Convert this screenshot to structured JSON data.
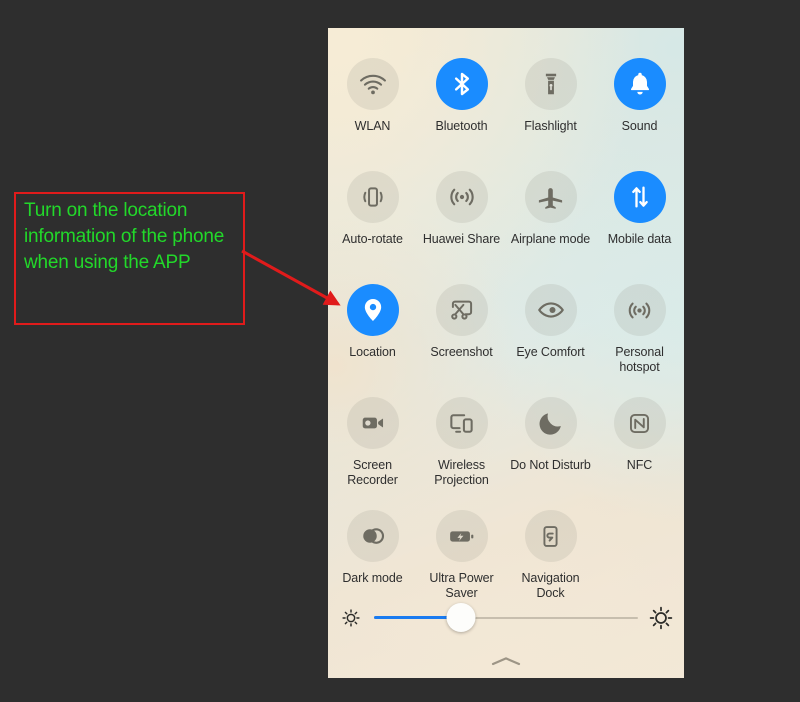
{
  "annotation": {
    "text": "Turn on the location information of the phone when using the APP",
    "border_color": "#e01b1b",
    "text_color": "#22d82a",
    "arrow_color": "#e01b1b",
    "arrow_target": "location-tile"
  },
  "panel": {
    "name": "quick-settings-panel",
    "active_color": "#1a8cff",
    "inactive_color": "rgba(140,140,130,0.17)",
    "tiles": [
      {
        "label": "WLAN",
        "icon": "wifi-icon",
        "state": "off"
      },
      {
        "label": "Bluetooth",
        "icon": "bluetooth-icon",
        "state": "on"
      },
      {
        "label": "Flashlight",
        "icon": "flashlight-icon",
        "state": "off"
      },
      {
        "label": "Sound",
        "icon": "bell-icon",
        "state": "on"
      },
      {
        "label": "Auto-rotate",
        "icon": "auto-rotate-icon",
        "state": "off"
      },
      {
        "label": "Huawei Share",
        "icon": "huawei-share-icon",
        "state": "off"
      },
      {
        "label": "Airplane mode",
        "icon": "airplane-icon",
        "state": "off"
      },
      {
        "label": "Mobile data",
        "icon": "mobile-data-arrows-icon",
        "state": "on"
      },
      {
        "label": "Location",
        "icon": "location-pin-icon",
        "state": "on"
      },
      {
        "label": "Screenshot",
        "icon": "screenshot-scissors-icon",
        "state": "off"
      },
      {
        "label": "Eye Comfort",
        "icon": "eye-icon",
        "state": "off"
      },
      {
        "label": "Personal hotspot",
        "icon": "hotspot-icon",
        "state": "off"
      },
      {
        "label": "Screen Recorder",
        "icon": "video-camera-icon",
        "state": "off"
      },
      {
        "label": "Wireless Projection",
        "icon": "cast-screen-icon",
        "state": "off"
      },
      {
        "label": "Do Not Disturb",
        "icon": "moon-icon",
        "state": "off"
      },
      {
        "label": "NFC",
        "icon": "nfc-icon",
        "state": "off"
      },
      {
        "label": "Dark mode",
        "icon": "dark-mode-circles-icon",
        "state": "off"
      },
      {
        "label": "Ultra Power Saver",
        "icon": "battery-bolt-icon",
        "state": "off"
      },
      {
        "label": "Navigation Dock",
        "icon": "navigation-dock-icon",
        "state": "off"
      }
    ],
    "brightness": {
      "name": "brightness-slider",
      "value_percent": 33,
      "left_icon": "brightness-low-icon",
      "right_icon": "brightness-high-icon",
      "fill_color": "#1a7bf0"
    },
    "collapse_handle": "chevron-up-handle"
  }
}
